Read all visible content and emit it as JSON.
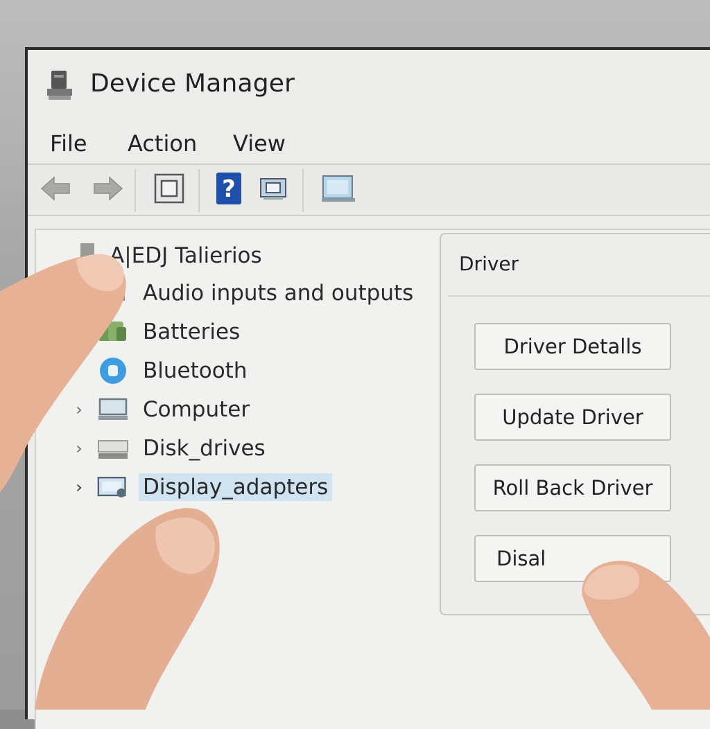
{
  "window": {
    "title": "Device Manager",
    "app_icon": "computer-icon"
  },
  "menu": {
    "items": [
      {
        "label": "File"
      },
      {
        "label": "Action"
      },
      {
        "label": "View"
      }
    ]
  },
  "toolbar": {
    "buttons": [
      {
        "icon": "back-arrow-icon"
      },
      {
        "icon": "forward-arrow-icon"
      },
      {
        "icon": "properties-icon"
      },
      {
        "icon": "help-icon"
      },
      {
        "icon": "scan-hardware-icon"
      },
      {
        "icon": "monitor-icon"
      }
    ]
  },
  "tree": {
    "root": {
      "label": "A|EDJ Talierios",
      "icon": "computer-icon"
    },
    "nodes": [
      {
        "label": "Audio inputs and outputs",
        "icon": "speaker-icon",
        "expander": ""
      },
      {
        "label": "Batteries",
        "icon": "battery-icon",
        "expander": ""
      },
      {
        "label": "Bluetooth",
        "icon": "bluetooth-icon",
        "expander": ""
      },
      {
        "label": "Computer",
        "icon": "computer-icon",
        "expander": "›"
      },
      {
        "label": "Disk_drives",
        "icon": "disk-drive-icon",
        "expander": "›"
      },
      {
        "label": "Display_adapters",
        "icon": "display-adapter-icon",
        "expander": "›",
        "selected": true
      }
    ]
  },
  "properties": {
    "tab_label": "Driver",
    "buttons": {
      "details": "Driver Detalls",
      "update": "Update Driver",
      "rollback": "Roll Back Driver",
      "disable": "Disal"
    }
  },
  "colors": {
    "selection": "#cfe3f0",
    "window_bg": "#ececea",
    "help_icon": "#1f4fa8"
  }
}
